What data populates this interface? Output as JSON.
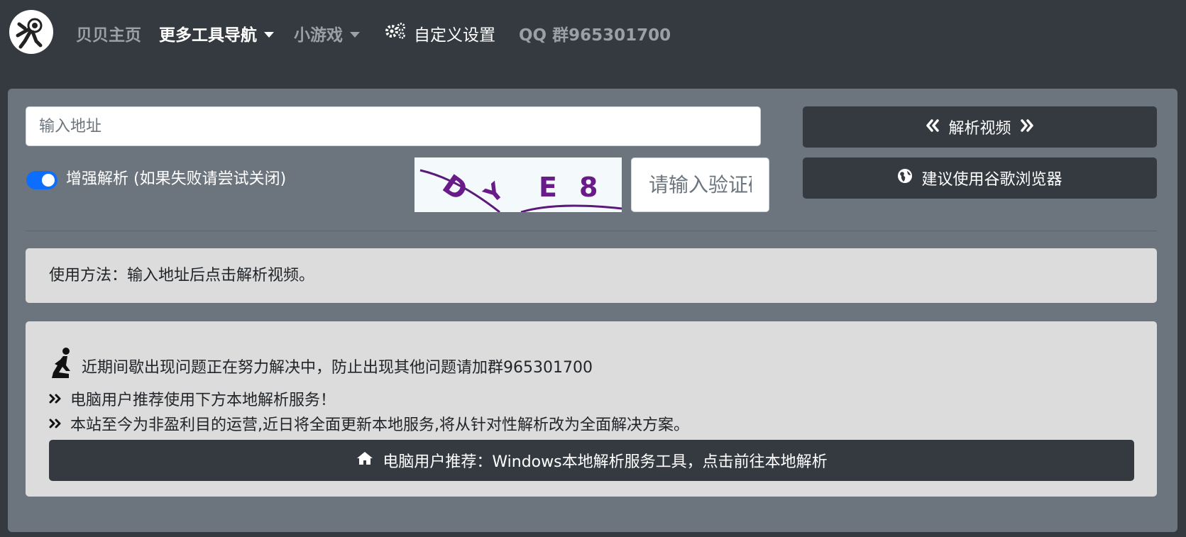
{
  "nav": {
    "home": "贝贝主页",
    "tools": "更多工具导航",
    "games": "小游戏",
    "settings": "自定义设置",
    "qq_group": "QQ 群965301700"
  },
  "form": {
    "url_placeholder": "输入地址",
    "parse_button": "解析视频",
    "browser_button": "建议使用谷歌浏览器",
    "enhance_label": "增强解析 (如果失败请尝试关闭)",
    "enhance_enabled": true,
    "captcha_text": "DYE8",
    "captcha_placeholder": "请输入验证码"
  },
  "usage": {
    "text": "使用方法：输入地址后点击解析视频。"
  },
  "notice": {
    "line1": "近期间歇出现问题正在努力解决中，防止出现其他问题请加群965301700",
    "line2": "电脑用户推荐使用下方本地解析服务！",
    "line3": "本站至今为非盈利目的运营,近日将全面更新本地服务,将从针对性解析改为全面解决方案。",
    "local_button": "电脑用户推荐：Windows本地解析服务工具，点击前往本地解析"
  },
  "icons": {
    "logo": "astronaut-logo-icon",
    "settings": "gears-icon",
    "parse_left": "angle-double-left-icon",
    "parse_right": "angle-double-right-icon",
    "browser": "globe-icon",
    "notice": "praying-person-icon",
    "bullet": "angle-double-right-icon",
    "local": "home-icon"
  },
  "colors": {
    "navbar_bg": "#343a40",
    "panel_bg": "#6c757d",
    "box_bg": "#dcdcdc",
    "button_dark": "#343a40",
    "switch_on": "#0d6efd",
    "captcha_ink": "#6a1b8a"
  }
}
